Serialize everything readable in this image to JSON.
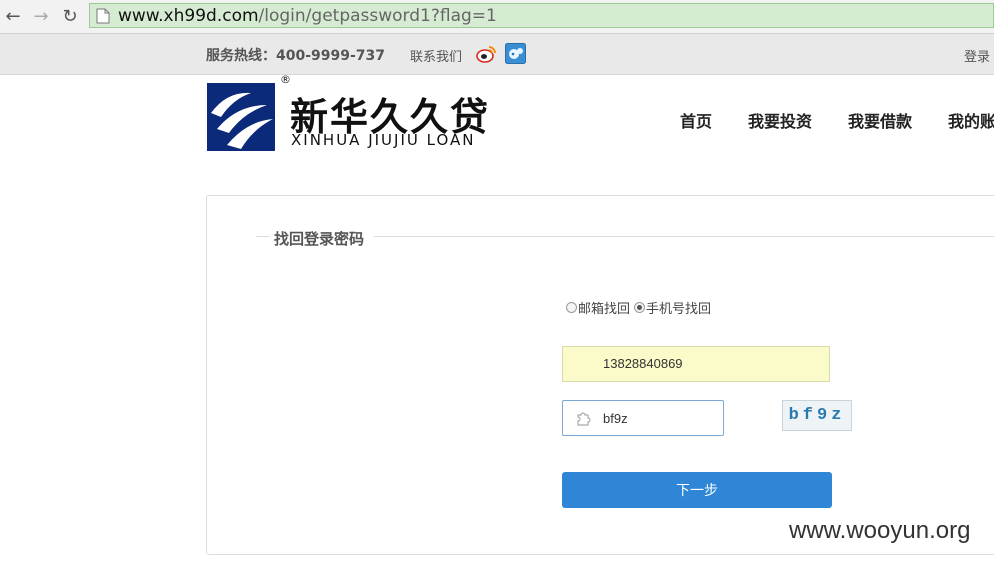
{
  "browser": {
    "url_host": "www.xh99d.com",
    "url_path": "/login/getpassword1?flag=1",
    "icons": [
      "back-icon",
      "forward-icon",
      "reload-icon",
      "page-icon"
    ]
  },
  "topbar": {
    "hotline": "服务热线：400-9999-737",
    "contact": "联系我们",
    "login": "登录",
    "icons": [
      "weibo-icon",
      "qq-icon"
    ]
  },
  "header": {
    "logo_cn": "新华久久贷",
    "logo_en": "XINHUA JIUJIU LOAN",
    "logo_reg": "®",
    "nav": [
      "首页",
      "我要投资",
      "我要借款",
      "我的账"
    ]
  },
  "form": {
    "title": "找回登录密码",
    "radio_email": "邮箱找回",
    "radio_phone": "手机号找回",
    "selected_method": "手机号找回",
    "phone_value": "13828840869",
    "captcha_value": "bf9z",
    "captcha_image_text": "bf9z",
    "next_button": "下一步"
  },
  "watermark": "www.wooyun.org",
  "colors": {
    "primary_button": "#2f86d6",
    "address_bar": "#d6ecd2",
    "autofill_bg": "#fafbc8",
    "logo_blue": "#0b2a7a"
  }
}
